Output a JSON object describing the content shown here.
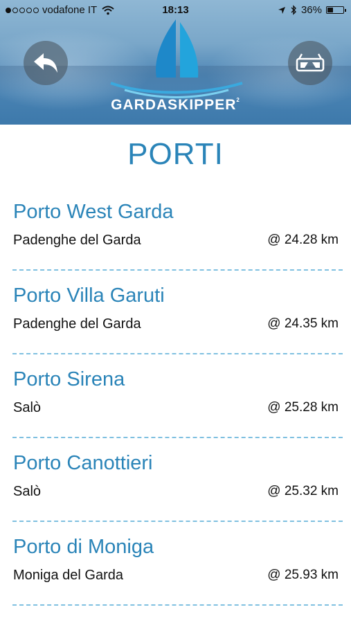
{
  "status_bar": {
    "carrier": "vodafone IT",
    "time": "18:13",
    "battery": "36%",
    "battery_level": 0.36,
    "signal_bars": 1
  },
  "header": {
    "logo_text": "GARDASKIPPER",
    "logo_superscript": "2",
    "back_icon": "reply-arrow-icon",
    "vr_icon": "vr-glasses-icon"
  },
  "page": {
    "title": "PORTI"
  },
  "ports": [
    {
      "name": "Porto West Garda",
      "place": "Padenghe del Garda",
      "distance": "@ 24.28 km"
    },
    {
      "name": "Porto Villa Garuti",
      "place": "Padenghe del Garda",
      "distance": "@ 24.35 km"
    },
    {
      "name": "Porto Sirena",
      "place": "Salò",
      "distance": "@ 25.28 km"
    },
    {
      "name": "Porto Canottieri",
      "place": "Salò",
      "distance": "@ 25.32 km"
    },
    {
      "name": "Porto di Moniga",
      "place": "Moniga del Garda",
      "distance": "@ 25.93 km"
    }
  ],
  "colors": {
    "accent": "#2a84b8",
    "separator": "#7fc0e0"
  }
}
